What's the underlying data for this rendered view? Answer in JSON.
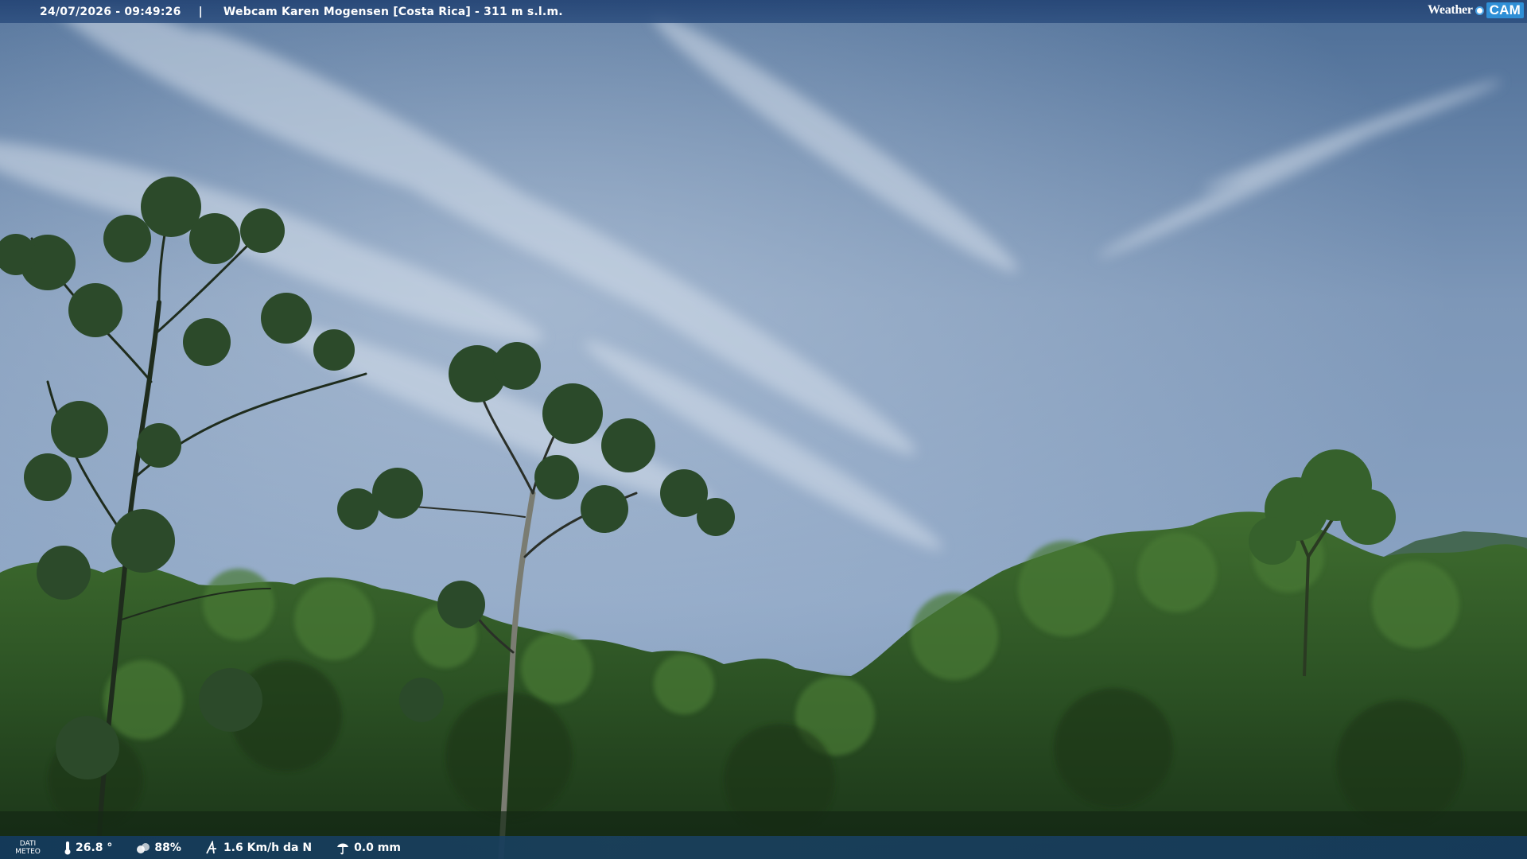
{
  "top_bar": {
    "datetime": "24/07/2026 - 09:49:26",
    "separator": "|",
    "title": "Webcam Karen Mogensen [Costa Rica] - 311 m s.l.m.",
    "logo": {
      "weather": "Weather",
      "cam": "CAM"
    }
  },
  "bottom_bar": {
    "dati_line1": "DATI",
    "dati_line2": "METEO",
    "temperature": "26.8 °",
    "humidity": "88%",
    "wind": "1.6 Km/h da N",
    "rain": "0.0 mm",
    "icons": [
      "thermometer-icon",
      "humidity-icon",
      "wind-icon",
      "rain-icon"
    ]
  },
  "colors": {
    "sky_top": "#4f6f97",
    "sky_mid": "#8ea6c4",
    "forest_dark": "#1f3a1c",
    "forest_mid": "#3c6a2c",
    "bar_top": "#284a78",
    "bar_bottom": "#1a4064"
  }
}
